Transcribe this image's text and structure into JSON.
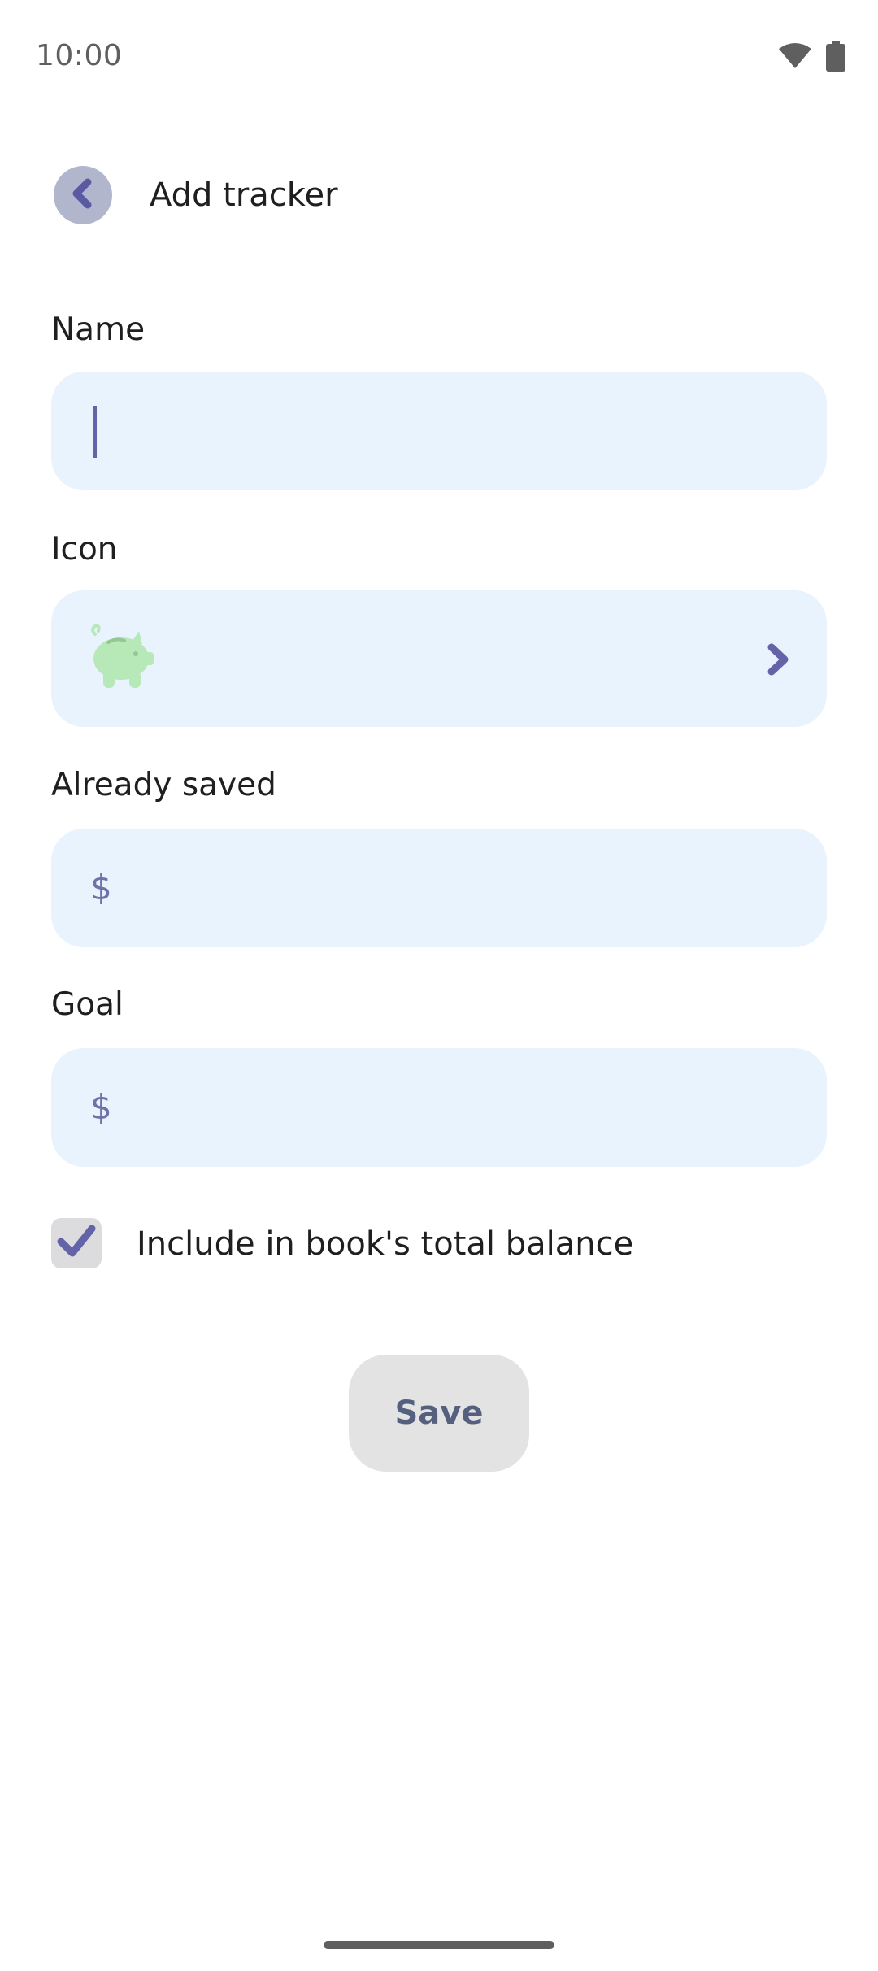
{
  "status_bar": {
    "time": "10:00",
    "icons": [
      "wifi-icon",
      "battery-icon"
    ]
  },
  "header": {
    "back_icon": "chevron-left-icon",
    "title": "Add tracker"
  },
  "form": {
    "name": {
      "label": "Name",
      "value": ""
    },
    "icon": {
      "label": "Icon",
      "selected_icon": "piggy-bank-icon",
      "chevron_icon": "chevron-right-icon"
    },
    "already_saved": {
      "label": "Already saved",
      "currency": "$",
      "value": ""
    },
    "goal": {
      "label": "Goal",
      "currency": "$",
      "value": ""
    },
    "include_total": {
      "label": "Include in book's total balance",
      "checked": true
    },
    "save_label": "Save"
  },
  "colors": {
    "accent": "#6563a8",
    "field_background": "#e8f3fe",
    "back_button_background": "#b2b6cd",
    "piggy_bank": "#b7e8b7",
    "save_text": "#55607f"
  }
}
